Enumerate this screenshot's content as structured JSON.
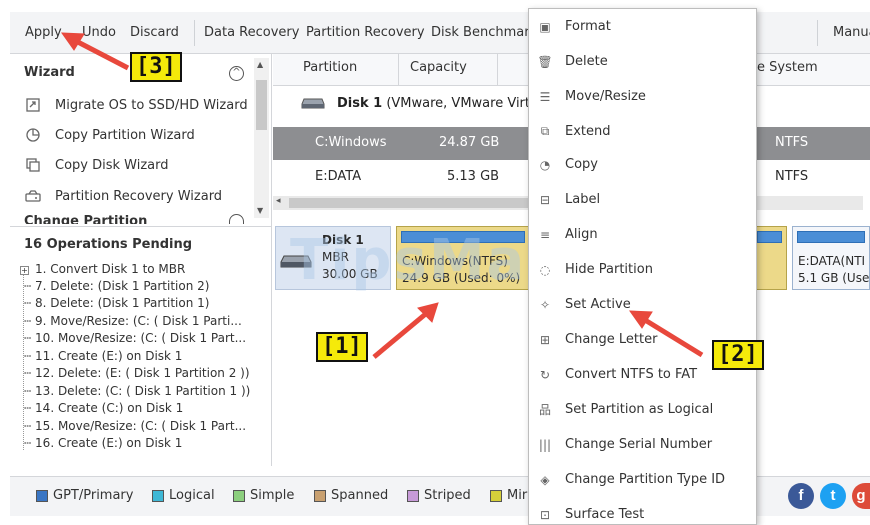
{
  "toolbar": {
    "apply": "Apply",
    "undo": "Undo",
    "discard": "Discard",
    "data_recovery": "Data Recovery",
    "partition_recovery": "Partition Recovery",
    "disk_benchmark": "Disk Benchmark",
    "manual": "Manua"
  },
  "left_panel": {
    "wizard_title": "Wizard",
    "wizard_items": [
      {
        "label": "Migrate OS to SSD/HD Wizard",
        "icon": "migrate-icon"
      },
      {
        "label": "Copy Partition Wizard",
        "icon": "copy-partition-icon"
      },
      {
        "label": "Copy Disk Wizard",
        "icon": "copy-disk-icon"
      },
      {
        "label": "Partition Recovery Wizard",
        "icon": "partition-recovery-icon"
      }
    ],
    "change_partition_partial": "Change Partition",
    "ops_title": "16 Operations Pending",
    "operations": [
      "1. Convert Disk 1 to MBR",
      "7. Delete: (Disk 1 Partition 2)",
      "8. Delete: (Disk 1 Partition 1)",
      "9. Move/Resize: (C: ( Disk 1 Parti...",
      "10. Move/Resize: (C: ( Disk 1 Part...",
      "11. Create (E:) on Disk 1",
      "12. Delete: (E: ( Disk 1 Partition 2 ))",
      "13. Delete: (C: ( Disk 1 Partition 1 ))",
      "14. Create (C:) on Disk 1",
      "15. Move/Resize: (C: ( Disk 1 Part...",
      "16. Create (E:) on Disk 1"
    ]
  },
  "table": {
    "headers": {
      "partition": "Partition",
      "capacity": "Capacity",
      "filesystem": "e System"
    },
    "disk_label": "Disk 1",
    "disk_desc": " (VMware, VMware Virt",
    "rows": [
      {
        "partition": "C:Windows",
        "capacity": "24.87 GB",
        "fs": "NTFS"
      },
      {
        "partition": "E:DATA",
        "capacity": "5.13 GB",
        "fs": "NTFS"
      }
    ]
  },
  "disk_map": {
    "disk_name": "Disk 1",
    "disk_type": "MBR",
    "disk_size": "30.00 GB",
    "c_name": "C:Windows(NTFS)",
    "c_size": "24.9 GB (Used: 0%)",
    "e_name": "E:DATA(NTI",
    "e_size": "5.1 GB (Use"
  },
  "context_menu": {
    "items": [
      {
        "label": "Format",
        "icon": "format-icon"
      },
      {
        "label": "Delete",
        "icon": "trash-icon"
      },
      {
        "label": "Move/Resize",
        "icon": "sliders-icon"
      },
      {
        "label": "Extend",
        "icon": "extend-icon"
      },
      {
        "label": "Copy",
        "icon": "copy-icon"
      },
      {
        "label": "Label",
        "icon": "label-icon"
      },
      {
        "label": "Align",
        "icon": "align-icon"
      },
      {
        "label": "Hide Partition",
        "icon": "hide-icon"
      },
      {
        "label": "Set Active",
        "icon": "pin-icon"
      },
      {
        "label": "Change Letter",
        "icon": "letter-icon"
      },
      {
        "label": "Convert NTFS to FAT",
        "icon": "convert-icon"
      },
      {
        "label": "Set Partition as Logical",
        "icon": "logical-icon"
      },
      {
        "label": "Change Serial Number",
        "icon": "barcode-icon"
      },
      {
        "label": "Change Partition Type ID",
        "icon": "type-id-icon"
      },
      {
        "label": "Surface Test",
        "icon": "surface-test-icon"
      }
    ]
  },
  "legend": {
    "items": [
      {
        "label": "GPT/Primary",
        "color": "#3a76c4"
      },
      {
        "label": "Logical",
        "color": "#3fb8d6"
      },
      {
        "label": "Simple",
        "color": "#8ccf7e"
      },
      {
        "label": "Spanned",
        "color": "#c8a070"
      },
      {
        "label": "Striped",
        "color": "#c79ad8"
      },
      {
        "label": "Mirr",
        "color": "#d6d03a"
      }
    ]
  },
  "annotations": {
    "callout_1": "[1]",
    "callout_2": "[2]",
    "callout_3": "[3]",
    "watermark": "TipsMake"
  },
  "colors": {
    "selection_row": "#8d8e91",
    "accent_blue": "#4b8ed6",
    "partition_yellow": "#ecd989",
    "arrow_red": "#e8483c"
  }
}
